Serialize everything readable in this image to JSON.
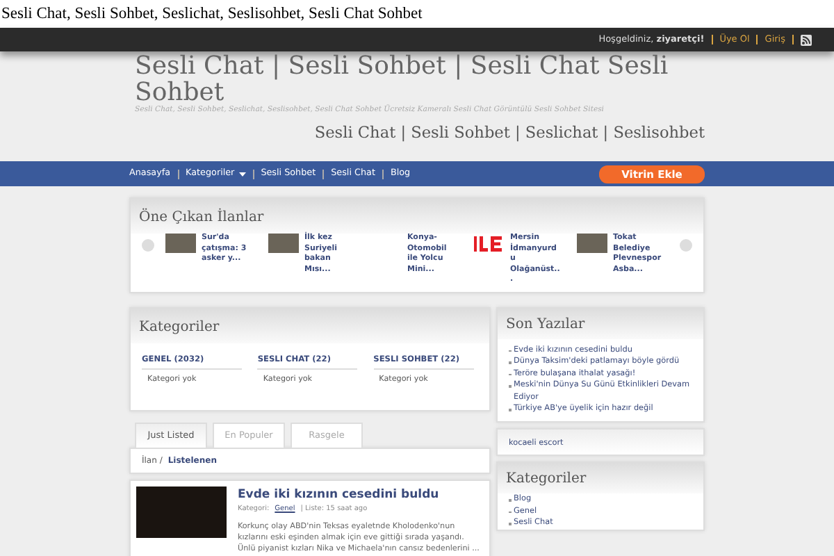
{
  "page_title": "Sesli Chat, Sesli Sohbet, Seslichat, Seslisohbet, Sesli Chat Sohbet",
  "topbar": {
    "greeting": "Hoşgeldiniz, **ziyaretçi!**",
    "links": [
      {
        "label": "Üye Ol"
      },
      {
        "label": "Giriş"
      }
    ]
  },
  "header": {
    "title": "Sesli Chat | Sesli Sohbet | Sesli Chat Sesli Sohbet",
    "tagline": "Sesli Chat, Sesli Sohbet, Seslichat, Seslisohbet, Sesli Chat Sohbet Ücretsiz Kameralı Sesli Chat Görüntülü Sesli Sohbet Sitesi",
    "subtitle": "Sesli Chat | Sesli Sohbet | Seslichat | Seslisohbet"
  },
  "nav": {
    "items": [
      {
        "label": "Anasayfa",
        "dropdown": false
      },
      {
        "label": "Kategoriler",
        "dropdown": true
      },
      {
        "label": "Sesli Sohbet",
        "dropdown": false
      },
      {
        "label": "Sesli Chat",
        "dropdown": false
      },
      {
        "label": "Blog",
        "dropdown": false
      }
    ],
    "button": "Vitrin Ekle"
  },
  "featured": {
    "title": "Öne Çıkan İlanlar",
    "items": [
      {
        "kind": "photo",
        "text": "Sur'da çatışma: 3 asker y..."
      },
      {
        "kind": "photo",
        "text": "İlk kez Suriyeli bakan Mısı..."
      },
      {
        "kind": "none",
        "text": "Konya-Otomobil ile Yolcu Mini..."
      },
      {
        "kind": "logo",
        "text": "Mersin İdmanyurdu Olağanüst..."
      },
      {
        "kind": "photo",
        "text": "Tokat Belediye Plevnespor Asba..."
      }
    ]
  },
  "categories": {
    "title": "Kategoriler",
    "columns": [
      {
        "name": "GENEL (2032)",
        "note": "Kategori yok"
      },
      {
        "name": "SESLI CHAT (22)",
        "note": "Kategori yok"
      },
      {
        "name": "SESLI SOHBET (22)",
        "note": "Kategori yok"
      }
    ]
  },
  "tabs": [
    {
      "label": "Just Listed",
      "selected": true
    },
    {
      "label": "En Populer",
      "selected": false
    },
    {
      "label": "Rasgele",
      "selected": false
    }
  ],
  "breadcrumb": {
    "parent": "İlan /",
    "current": "Listelenen"
  },
  "listings": [
    {
      "title": "Evde iki kızının cesedini buldu",
      "meta_prefix": "Kategori:",
      "category": "Genel",
      "meta_suffix": "| Liste: 15 saat ago",
      "excerpt": "Korkunç olay ABD'nin Teksas eyaletnde Kholodenko'nun kızlarını eski eşinden almak için eve gittiği sırada yaşandı. Ünlü piyanist kızları Nika ve Michaela'nın cansız bedenlerini ..."
    }
  ],
  "sidebar": {
    "recent_title": "Son Yazılar",
    "recent": [
      "Evde iki kızının cesedini buldu",
      "Dünya Taksim'deki patlamayı böyle gördü",
      "Teröre bulaşana ithalat yasağı!",
      "Meski'nin Dünya Su Günü Etkinlikleri Devam Ediyor",
      "Türkiye AB'ye üyelik için hazır değil"
    ],
    "link": "kocaeli escort",
    "categories_title": "Kategoriler",
    "categories": [
      "Blog",
      "Genel",
      "Sesli Chat"
    ]
  }
}
